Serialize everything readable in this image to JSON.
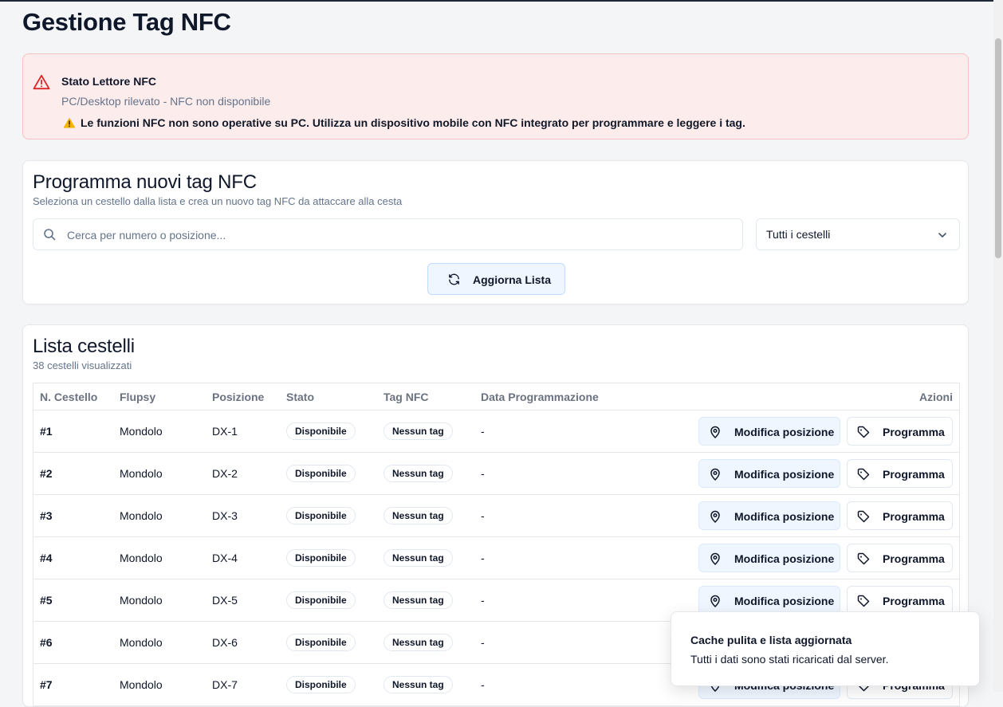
{
  "page": {
    "title": "Gestione Tag NFC"
  },
  "alert": {
    "title": "Stato Lettore NFC",
    "subtitle": "PC/Desktop rilevato - NFC non disponibile",
    "message": "Le funzioni NFC non sono operative su PC. Utilizza un dispositivo mobile con NFC integrato per programmare e leggere i tag.",
    "color": "#dc2626"
  },
  "program": {
    "title": "Programma nuovi tag NFC",
    "subtitle": "Seleziona un cestello dalla lista e crea un nuovo tag NFC da attaccare alla cesta",
    "search_placeholder": "Cerca per numero o posizione...",
    "filter_value": "Tutti i cestelli",
    "refresh_label": "Aggiorna Lista"
  },
  "list": {
    "title": "Lista cestelli",
    "count": "38 cestelli visualizzati",
    "headers": [
      "N. Cestello",
      "Flupsy",
      "Posizione",
      "Stato",
      "Tag NFC",
      "Data Programmazione",
      "Azioni"
    ],
    "edit_label": "Modifica posizione",
    "program_label": "Programma",
    "rows": [
      {
        "num": "#1",
        "flupsy": "Mondolo",
        "pos": "DX-1",
        "state": "Disponibile",
        "tag": "Nessun tag",
        "date": "-"
      },
      {
        "num": "#2",
        "flupsy": "Mondolo",
        "pos": "DX-2",
        "state": "Disponibile",
        "tag": "Nessun tag",
        "date": "-"
      },
      {
        "num": "#3",
        "flupsy": "Mondolo",
        "pos": "DX-3",
        "state": "Disponibile",
        "tag": "Nessun tag",
        "date": "-"
      },
      {
        "num": "#4",
        "flupsy": "Mondolo",
        "pos": "DX-4",
        "state": "Disponibile",
        "tag": "Nessun tag",
        "date": "-"
      },
      {
        "num": "#5",
        "flupsy": "Mondolo",
        "pos": "DX-5",
        "state": "Disponibile",
        "tag": "Nessun tag",
        "date": "-"
      },
      {
        "num": "#6",
        "flupsy": "Mondolo",
        "pos": "DX-6",
        "state": "Disponibile",
        "tag": "Nessun tag",
        "date": "-"
      },
      {
        "num": "#7",
        "flupsy": "Mondolo",
        "pos": "DX-7",
        "state": "Disponibile",
        "tag": "Nessun tag",
        "date": "-"
      }
    ]
  },
  "toast": {
    "title": "Cache pulita e lista aggiornata",
    "message": "Tutti i dati sono stati ricaricati dal server."
  }
}
